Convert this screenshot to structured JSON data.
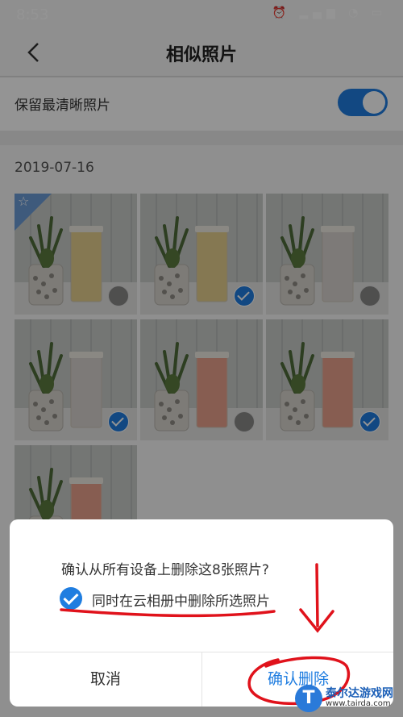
{
  "status": {
    "time": "8:53",
    "icons": "⏰ ▂▄▆ ◔ ▭"
  },
  "header": {
    "title": "相似照片"
  },
  "settings": {
    "keep_clearest_label": "保留最清晰照片",
    "keep_clearest_on": true
  },
  "date_label": "2019-07-16",
  "photos": [
    {
      "cup": "yellow",
      "selected": false,
      "best": true
    },
    {
      "cup": "yellow",
      "selected": true,
      "best": false
    },
    {
      "cup": "white",
      "selected": false,
      "best": false
    },
    {
      "cup": "white",
      "selected": true,
      "best": false
    },
    {
      "cup": "pink",
      "selected": false,
      "best": false
    },
    {
      "cup": "pink",
      "selected": true,
      "best": false
    },
    {
      "cup": "pink",
      "selected": false,
      "best": false
    }
  ],
  "dialog": {
    "message": "确认从所有设备上删除这8张照片?",
    "option_label": "同时在云相册中删除所选照片",
    "option_checked": true,
    "cancel_label": "取消",
    "confirm_label": "确认删除"
  },
  "watermark": {
    "name": "泰尔达游戏网",
    "url": "www.tairda.com",
    "logo_letter": "T"
  },
  "colors": {
    "accent": "#1f7de0",
    "annotation": "#e0121b"
  }
}
